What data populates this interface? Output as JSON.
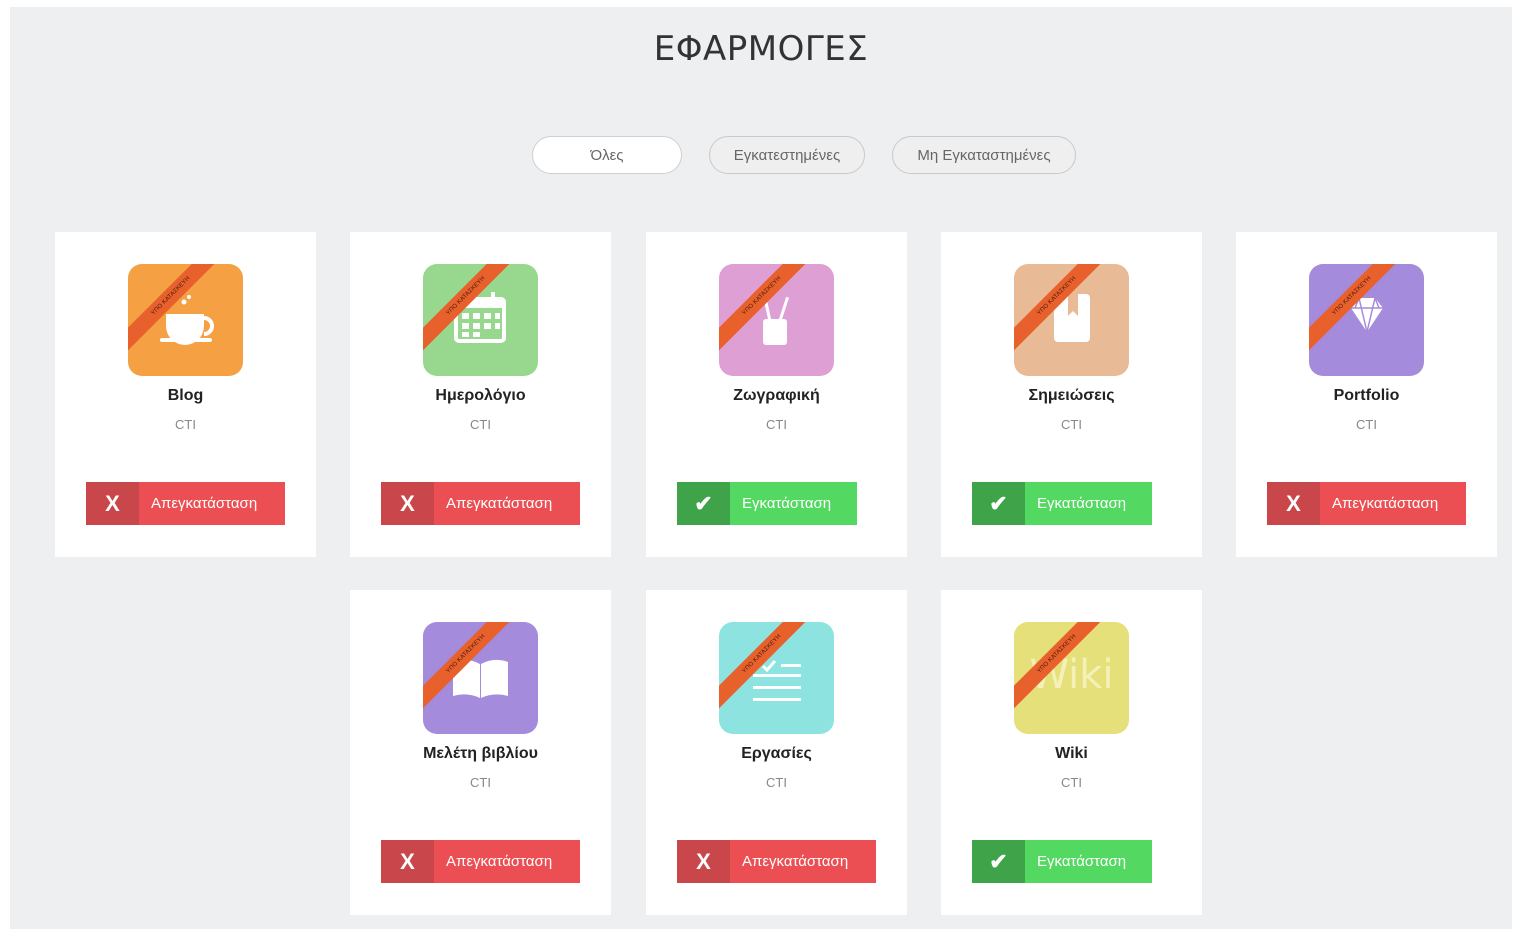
{
  "page": {
    "title": "ΕΦΑΡΜΟΓΕΣ",
    "filters": [
      {
        "label": "Όλες",
        "active": true
      },
      {
        "label": "Εγκατεστημένες",
        "active": false
      },
      {
        "label": "Μη Εγκαταστημένες",
        "active": false
      }
    ]
  },
  "ribbon_text": "ΥΠΟ ΚΑΤΑΣΚΕΥΗ",
  "labels": {
    "uninstall": "Απεγκατάσταση",
    "install": "Εγκατάσταση",
    "x_mark": "X",
    "check_mark": "✔"
  },
  "apps": [
    {
      "name": "Blog",
      "vendor": "CTI",
      "icon": "coffee-cup-icon",
      "color": "#f5a042",
      "status": "uninstall"
    },
    {
      "name": "Ημερολόγιο",
      "vendor": "CTI",
      "icon": "calendar-icon",
      "color": "#98d88e",
      "status": "uninstall"
    },
    {
      "name": "Ζωγραφική",
      "vendor": "CTI",
      "icon": "brush-cup-icon",
      "color": "#dea0d4",
      "status": "install"
    },
    {
      "name": "Σημειώσεις",
      "vendor": "CTI",
      "icon": "notebook-icon",
      "color": "#e8bb96",
      "status": "install"
    },
    {
      "name": "Portfolio",
      "vendor": "CTI",
      "icon": "diamond-icon",
      "color": "#a48bdc",
      "status": "uninstall"
    },
    {
      "name": "Μελέτη βιβλίου",
      "vendor": "CTI",
      "icon": "open-book-icon",
      "color": "#a48bdc",
      "status": "uninstall"
    },
    {
      "name": "Εργασίες",
      "vendor": "CTI",
      "icon": "task-list-icon",
      "color": "#8de3df",
      "status": "uninstall"
    },
    {
      "name": "Wiki",
      "vendor": "CTI",
      "icon": "wiki-icon",
      "icon_text": "Wiki",
      "color": "#e6e07a",
      "status": "install"
    }
  ]
}
